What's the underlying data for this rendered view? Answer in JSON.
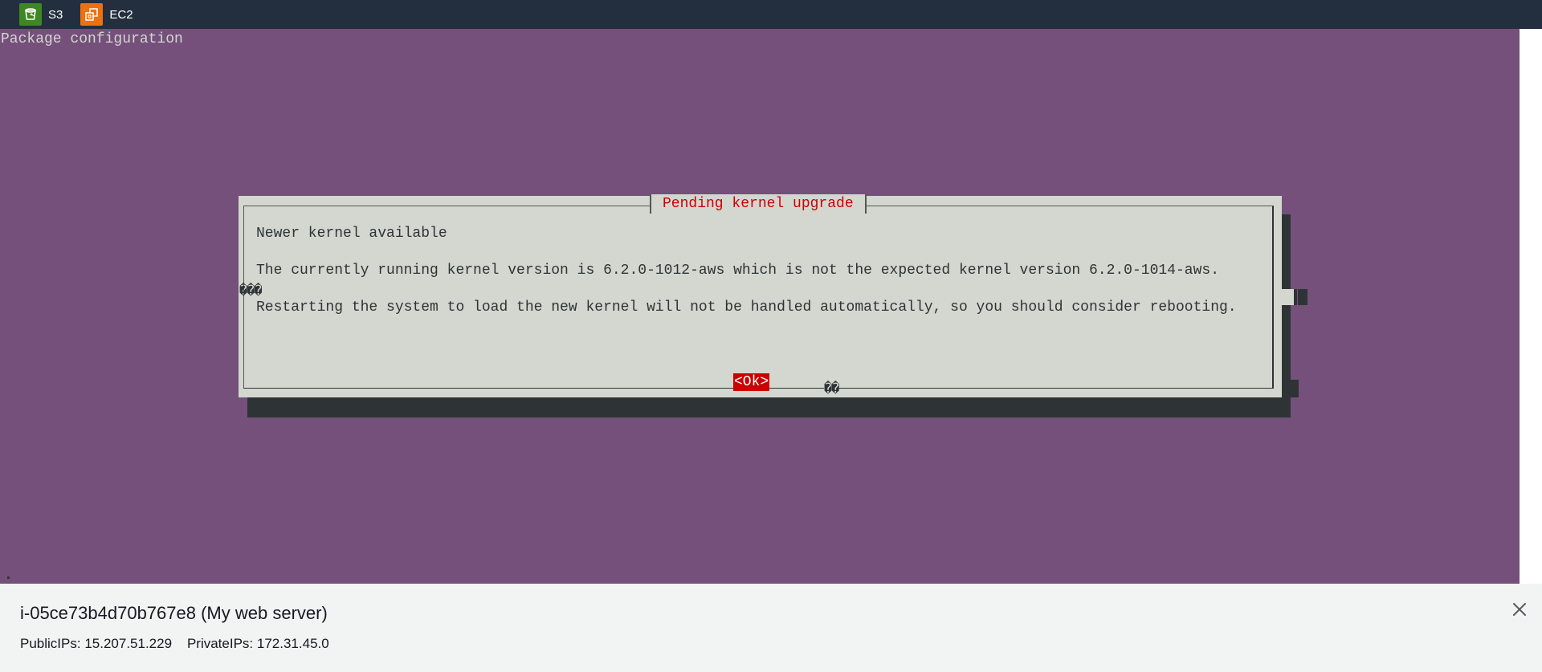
{
  "top_bar": {
    "services": [
      {
        "label": "S3",
        "icon": "s3-bucket-icon",
        "color": "#3f8624"
      },
      {
        "label": "EC2",
        "icon": "ec2-instances-icon",
        "color": "#ec7211"
      }
    ]
  },
  "terminal": {
    "background": "#75507b",
    "header": "Package configuration",
    "dialog": {
      "title": "Pending kernel upgrade",
      "heading": "Newer kernel available",
      "line1": "The currently running kernel version is 6.2.0-1012-aws which is not the expected kernel version 6.2.0-1014-aws.",
      "garbled_left": "���",
      "line2": "Restarting the system to load the new kernel will not be handled automatically, so you should consider rebooting.",
      "ok_label": "<Ok>",
      "garbled_bottom": "��"
    }
  },
  "instance_panel": {
    "title": "i-05ce73b4d70b767e8 (My web server)",
    "public_ips_label": "PublicIPs:",
    "public_ips_value": "15.207.51.229",
    "private_ips_label": "PrivateIPs:",
    "private_ips_value": "172.31.45.0"
  }
}
